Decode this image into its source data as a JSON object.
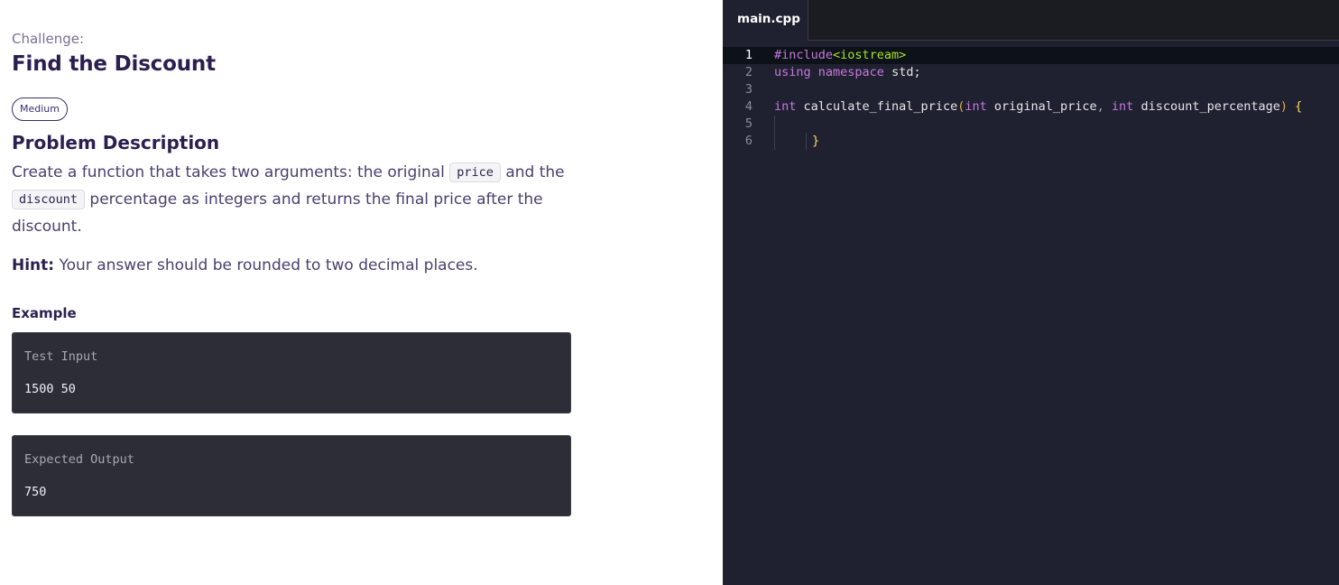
{
  "problem": {
    "challenge_label": "Challenge:",
    "title": "Find the Discount",
    "difficulty": "Medium",
    "section_title": "Problem Description",
    "desc_part1": "Create a function that takes two arguments: the original ",
    "code_price": "price",
    "desc_part2": " and the ",
    "code_discount": "discount",
    "desc_part3": " percentage as integers and returns the final price after the discount.",
    "hint_label": "Hint:",
    "hint_text": " Your answer should be rounded to two decimal places.",
    "example_label": "Example",
    "test_input_title": "Test Input",
    "test_input_value": "1500 50",
    "expected_output_title": "Expected Output",
    "expected_output_value": "750"
  },
  "editor": {
    "tab_label": "main.cpp",
    "line_numbers": [
      "1",
      "2",
      "3",
      "4",
      "5",
      "6"
    ],
    "code": {
      "l1_directive": "#include",
      "l1_header": "<iostream>",
      "l2_using": "using",
      "l2_namespace": "namespace",
      "l2_rest": " std;",
      "l4_int1": "int",
      "l4_fn": " calculate_final_price",
      "l4_open": "(",
      "l4_int2": "int",
      "l4_p1": " original_price",
      "l4_comma": ",",
      "l4_int3": " int",
      "l4_p2": " discount_percentage",
      "l4_close": ")",
      "l4_brace": " {",
      "l6_brace": "}"
    }
  },
  "colors": {
    "editor_bg": "#1f2130",
    "keyword": "#c678dd",
    "string": "#a6e22e",
    "brace": "#ffd866",
    "heading": "#2a1f4f"
  }
}
